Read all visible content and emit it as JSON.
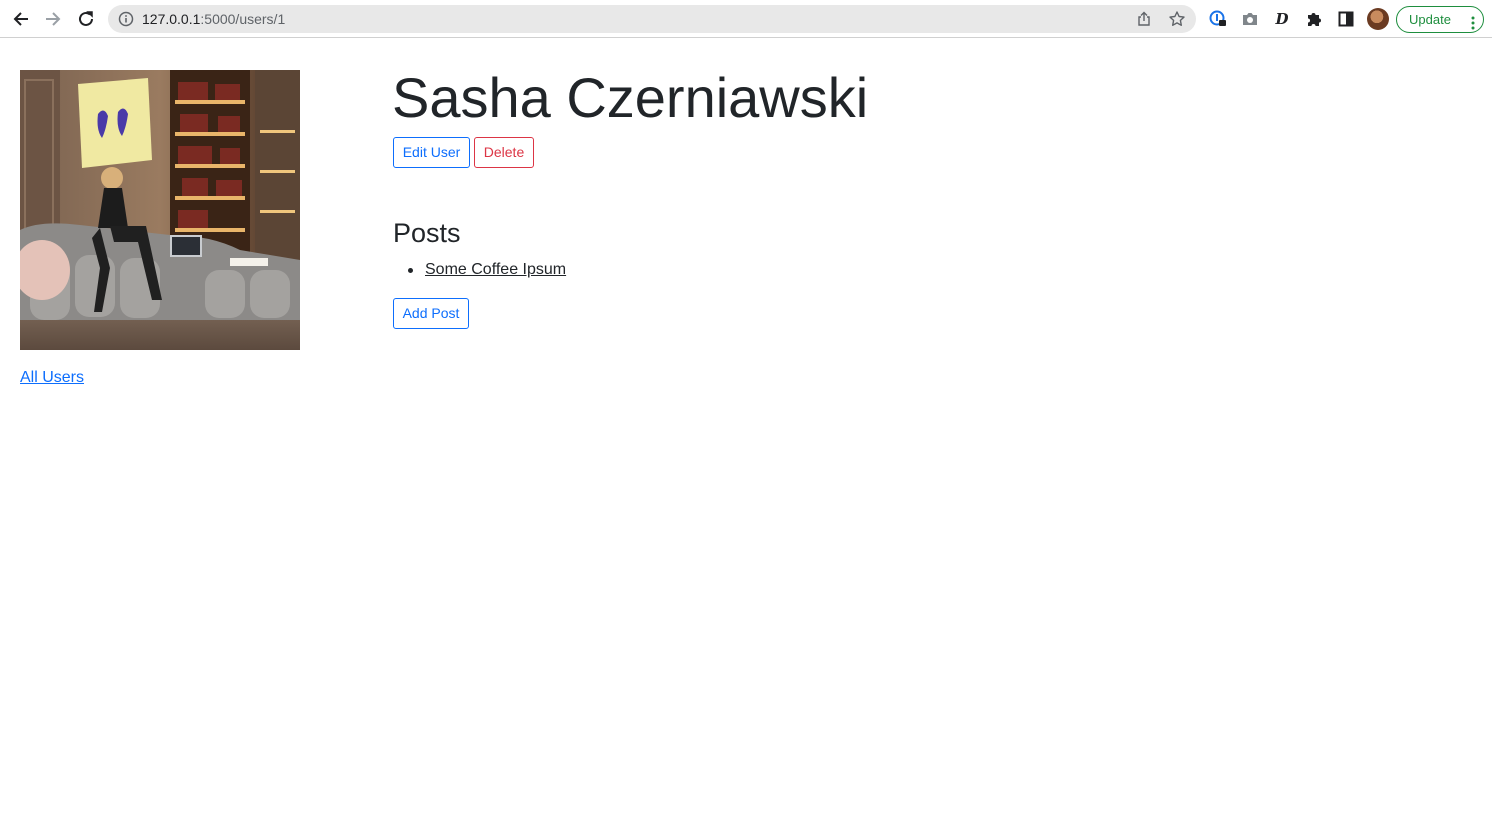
{
  "browser": {
    "url_host": "127.0.0.1",
    "url_path": ":5000/users/1",
    "update_label": "Update"
  },
  "user": {
    "name": "Sasha Czerniawski",
    "edit_label": "Edit User",
    "delete_label": "Delete",
    "all_users_label": "All Users"
  },
  "posts": {
    "heading": "Posts",
    "items": [
      {
        "title": "Some Coffee Ipsum"
      }
    ],
    "add_label": "Add Post"
  },
  "colors": {
    "primary": "#0d6efd",
    "danger": "#dc3545",
    "update_green": "#1e8e3e"
  }
}
